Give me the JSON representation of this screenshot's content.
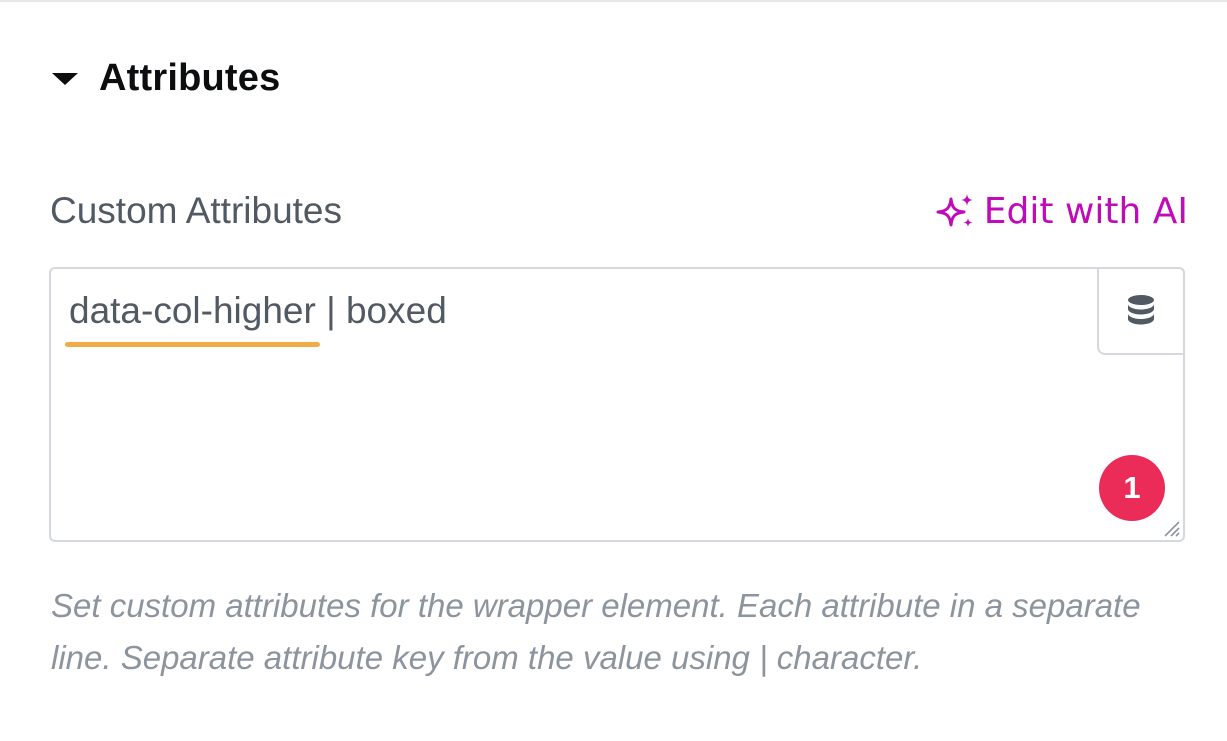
{
  "section": {
    "title": "Attributes",
    "toggle_icon": "caret-down-icon"
  },
  "custom_attributes": {
    "label": "Custom Attributes",
    "ai_button": {
      "label": "Edit with AI",
      "icon": "sparkles-icon",
      "color": "#c00bb9"
    },
    "textarea": {
      "value_misspelled": "data-col-higher",
      "value_rest": " | boxed"
    },
    "dynamic_tags_icon": "database-icon",
    "badge": {
      "count": "1",
      "color": "#eb2c59"
    },
    "spellcheck_color": "#f1ad45",
    "help_text": "Set custom attributes for the wrapper element. Each attribute in a separate line. Separate attribute key from the value using | character."
  }
}
